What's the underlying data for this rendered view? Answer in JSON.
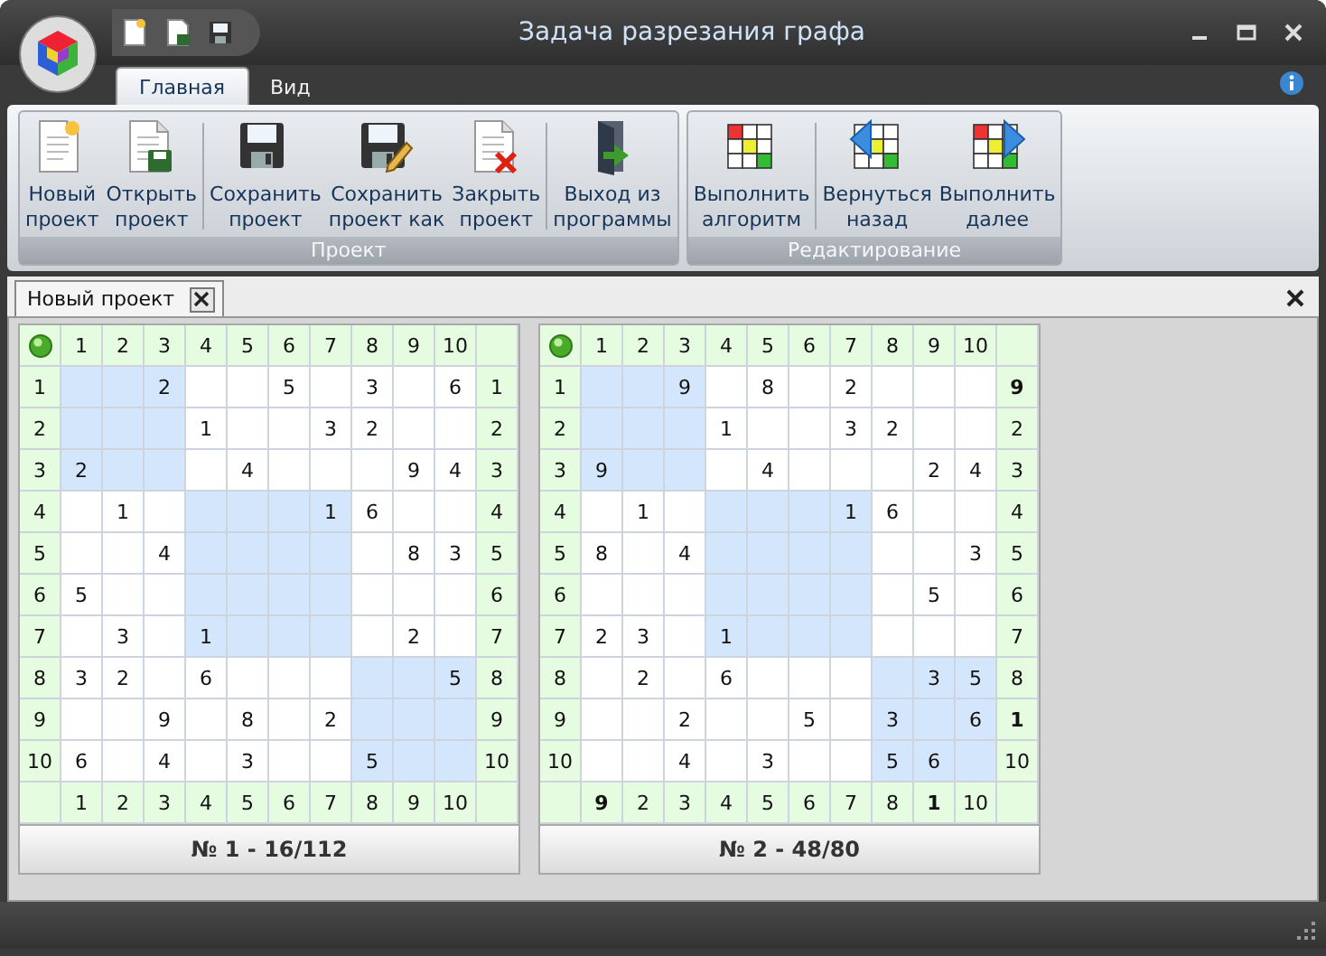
{
  "window": {
    "title": "Задача разрезания графа"
  },
  "ribbon_tabs": [
    {
      "label": "Главная",
      "selected": true
    },
    {
      "label": "Вид",
      "selected": false
    }
  ],
  "ribbon_groups": [
    {
      "title": "Проект",
      "sets": [
        [
          {
            "kind": "new",
            "label": "Новый\nпроект"
          },
          {
            "kind": "open",
            "label": "Открыть\nпроект"
          }
        ],
        [
          {
            "kind": "save",
            "label": "Сохранить\nпроект"
          },
          {
            "kind": "saveas",
            "label": "Сохранить\nпроект как"
          },
          {
            "kind": "close",
            "label": "Закрыть\nпроект"
          }
        ],
        [
          {
            "kind": "exit",
            "label": "Выход из\nпрограммы"
          }
        ]
      ]
    },
    {
      "title": "Редактирование",
      "sets": [
        [
          {
            "kind": "run",
            "label": "Выполнить\nалгоритм"
          }
        ],
        [
          {
            "kind": "back",
            "label": "Вернуться\nназад"
          },
          {
            "kind": "forward",
            "label": "Выполнить\nдалее"
          }
        ]
      ]
    }
  ],
  "document_tabs": [
    {
      "label": "Новый проект"
    }
  ],
  "grids": [
    {
      "title": "№ 1 - 16/112",
      "columns": [
        {
          "text": "1"
        },
        {
          "text": "2"
        },
        {
          "text": "3"
        },
        {
          "text": "4"
        },
        {
          "text": "5"
        },
        {
          "text": "6"
        },
        {
          "text": "7"
        },
        {
          "text": "8"
        },
        {
          "text": "9"
        },
        {
          "text": "10"
        }
      ],
      "bottom": [
        {
          "text": "1",
          "bold": false
        },
        {
          "text": "2",
          "bold": false
        },
        {
          "text": "3",
          "bold": false
        },
        {
          "text": "4",
          "bold": false
        },
        {
          "text": "5",
          "bold": false
        },
        {
          "text": "6",
          "bold": false
        },
        {
          "text": "7",
          "bold": false
        },
        {
          "text": "8",
          "bold": false
        },
        {
          "text": "9",
          "bold": false
        },
        {
          "text": "10",
          "bold": false
        }
      ],
      "rows": [
        {
          "label": "1",
          "cells": [
            null,
            null,
            "2",
            null,
            null,
            "5",
            null,
            "3",
            null,
            "6"
          ],
          "shaded": [
            true,
            true,
            true,
            false,
            false,
            false,
            false,
            false,
            false,
            false
          ],
          "end": {
            "text": "1",
            "bold": false
          }
        },
        {
          "label": "2",
          "cells": [
            null,
            null,
            null,
            "1",
            null,
            null,
            "3",
            "2",
            null,
            null
          ],
          "shaded": [
            true,
            true,
            true,
            false,
            false,
            false,
            false,
            false,
            false,
            false
          ],
          "end": {
            "text": "2",
            "bold": false
          }
        },
        {
          "label": "3",
          "cells": [
            "2",
            null,
            null,
            null,
            "4",
            null,
            null,
            null,
            "9",
            "4"
          ],
          "shaded": [
            true,
            true,
            true,
            false,
            false,
            false,
            false,
            false,
            false,
            false
          ],
          "end": {
            "text": "3",
            "bold": false
          }
        },
        {
          "label": "4",
          "cells": [
            null,
            "1",
            null,
            null,
            null,
            null,
            "1",
            "6",
            null,
            null
          ],
          "shaded": [
            false,
            false,
            false,
            true,
            true,
            true,
            true,
            false,
            false,
            false
          ],
          "end": {
            "text": "4",
            "bold": false
          }
        },
        {
          "label": "5",
          "cells": [
            null,
            null,
            "4",
            null,
            null,
            null,
            null,
            null,
            "8",
            "3"
          ],
          "shaded": [
            false,
            false,
            false,
            true,
            true,
            true,
            true,
            false,
            false,
            false
          ],
          "end": {
            "text": "5",
            "bold": false
          }
        },
        {
          "label": "6",
          "cells": [
            "5",
            null,
            null,
            null,
            null,
            null,
            null,
            null,
            null,
            null
          ],
          "shaded": [
            false,
            false,
            false,
            true,
            true,
            true,
            true,
            false,
            false,
            false
          ],
          "end": {
            "text": "6",
            "bold": false
          }
        },
        {
          "label": "7",
          "cells": [
            null,
            "3",
            null,
            "1",
            null,
            null,
            null,
            null,
            "2",
            null
          ],
          "shaded": [
            false,
            false,
            false,
            true,
            true,
            true,
            true,
            false,
            false,
            false
          ],
          "end": {
            "text": "7",
            "bold": false
          }
        },
        {
          "label": "8",
          "cells": [
            "3",
            "2",
            null,
            "6",
            null,
            null,
            null,
            null,
            null,
            "5"
          ],
          "shaded": [
            false,
            false,
            false,
            false,
            false,
            false,
            false,
            true,
            true,
            true
          ],
          "end": {
            "text": "8",
            "bold": false
          }
        },
        {
          "label": "9",
          "cells": [
            null,
            null,
            "9",
            null,
            "8",
            null,
            "2",
            null,
            null,
            null
          ],
          "shaded": [
            false,
            false,
            false,
            false,
            false,
            false,
            false,
            true,
            true,
            true
          ],
          "end": {
            "text": "9",
            "bold": false
          }
        },
        {
          "label": "10",
          "cells": [
            "6",
            null,
            "4",
            null,
            "3",
            null,
            null,
            "5",
            null,
            null
          ],
          "shaded": [
            false,
            false,
            false,
            false,
            false,
            false,
            false,
            true,
            true,
            true
          ],
          "end": {
            "text": "10",
            "bold": false
          }
        }
      ]
    },
    {
      "title": "№ 2 - 48/80",
      "columns": [
        {
          "text": "1"
        },
        {
          "text": "2"
        },
        {
          "text": "3"
        },
        {
          "text": "4"
        },
        {
          "text": "5"
        },
        {
          "text": "6"
        },
        {
          "text": "7"
        },
        {
          "text": "8"
        },
        {
          "text": "9"
        },
        {
          "text": "10"
        }
      ],
      "bottom": [
        {
          "text": "9",
          "bold": true
        },
        {
          "text": "2",
          "bold": false
        },
        {
          "text": "3",
          "bold": false
        },
        {
          "text": "4",
          "bold": false
        },
        {
          "text": "5",
          "bold": false
        },
        {
          "text": "6",
          "bold": false
        },
        {
          "text": "7",
          "bold": false
        },
        {
          "text": "8",
          "bold": false
        },
        {
          "text": "1",
          "bold": true
        },
        {
          "text": "10",
          "bold": false
        }
      ],
      "rows": [
        {
          "label": "1",
          "cells": [
            null,
            null,
            "9",
            null,
            "8",
            null,
            "2",
            null,
            null,
            null
          ],
          "shaded": [
            true,
            true,
            true,
            false,
            false,
            false,
            false,
            false,
            false,
            false
          ],
          "end": {
            "text": "9",
            "bold": true
          }
        },
        {
          "label": "2",
          "cells": [
            null,
            null,
            null,
            "1",
            null,
            null,
            "3",
            "2",
            null,
            null
          ],
          "shaded": [
            true,
            true,
            true,
            false,
            false,
            false,
            false,
            false,
            false,
            false
          ],
          "end": {
            "text": "2",
            "bold": false
          }
        },
        {
          "label": "3",
          "cells": [
            "9",
            null,
            null,
            null,
            "4",
            null,
            null,
            null,
            "2",
            "4"
          ],
          "shaded": [
            true,
            true,
            true,
            false,
            false,
            false,
            false,
            false,
            false,
            false
          ],
          "end": {
            "text": "3",
            "bold": false
          }
        },
        {
          "label": "4",
          "cells": [
            null,
            "1",
            null,
            null,
            null,
            null,
            "1",
            "6",
            null,
            null
          ],
          "shaded": [
            false,
            false,
            false,
            true,
            true,
            true,
            true,
            false,
            false,
            false
          ],
          "end": {
            "text": "4",
            "bold": false
          }
        },
        {
          "label": "5",
          "cells": [
            "8",
            null,
            "4",
            null,
            null,
            null,
            null,
            null,
            null,
            "3"
          ],
          "shaded": [
            false,
            false,
            false,
            true,
            true,
            true,
            true,
            false,
            false,
            false
          ],
          "end": {
            "text": "5",
            "bold": false
          }
        },
        {
          "label": "6",
          "cells": [
            null,
            null,
            null,
            null,
            null,
            null,
            null,
            null,
            "5",
            null
          ],
          "shaded": [
            false,
            false,
            false,
            true,
            true,
            true,
            true,
            false,
            false,
            false
          ],
          "end": {
            "text": "6",
            "bold": false
          }
        },
        {
          "label": "7",
          "cells": [
            "2",
            "3",
            null,
            "1",
            null,
            null,
            null,
            null,
            null,
            null
          ],
          "shaded": [
            false,
            false,
            false,
            true,
            true,
            true,
            true,
            false,
            false,
            false
          ],
          "end": {
            "text": "7",
            "bold": false
          }
        },
        {
          "label": "8",
          "cells": [
            null,
            "2",
            null,
            "6",
            null,
            null,
            null,
            null,
            "3",
            "5"
          ],
          "shaded": [
            false,
            false,
            false,
            false,
            false,
            false,
            false,
            true,
            true,
            true
          ],
          "end": {
            "text": "8",
            "bold": false
          }
        },
        {
          "label": "9",
          "cells": [
            null,
            null,
            "2",
            null,
            null,
            "5",
            null,
            "3",
            null,
            "6"
          ],
          "shaded": [
            false,
            false,
            false,
            false,
            false,
            false,
            false,
            true,
            true,
            true
          ],
          "end": {
            "text": "1",
            "bold": true
          }
        },
        {
          "label": "10",
          "cells": [
            null,
            null,
            "4",
            null,
            "3",
            null,
            null,
            "5",
            "6",
            null
          ],
          "shaded": [
            false,
            false,
            false,
            false,
            false,
            false,
            false,
            true,
            true,
            true
          ],
          "end": {
            "text": "10",
            "bold": false
          }
        }
      ]
    }
  ]
}
